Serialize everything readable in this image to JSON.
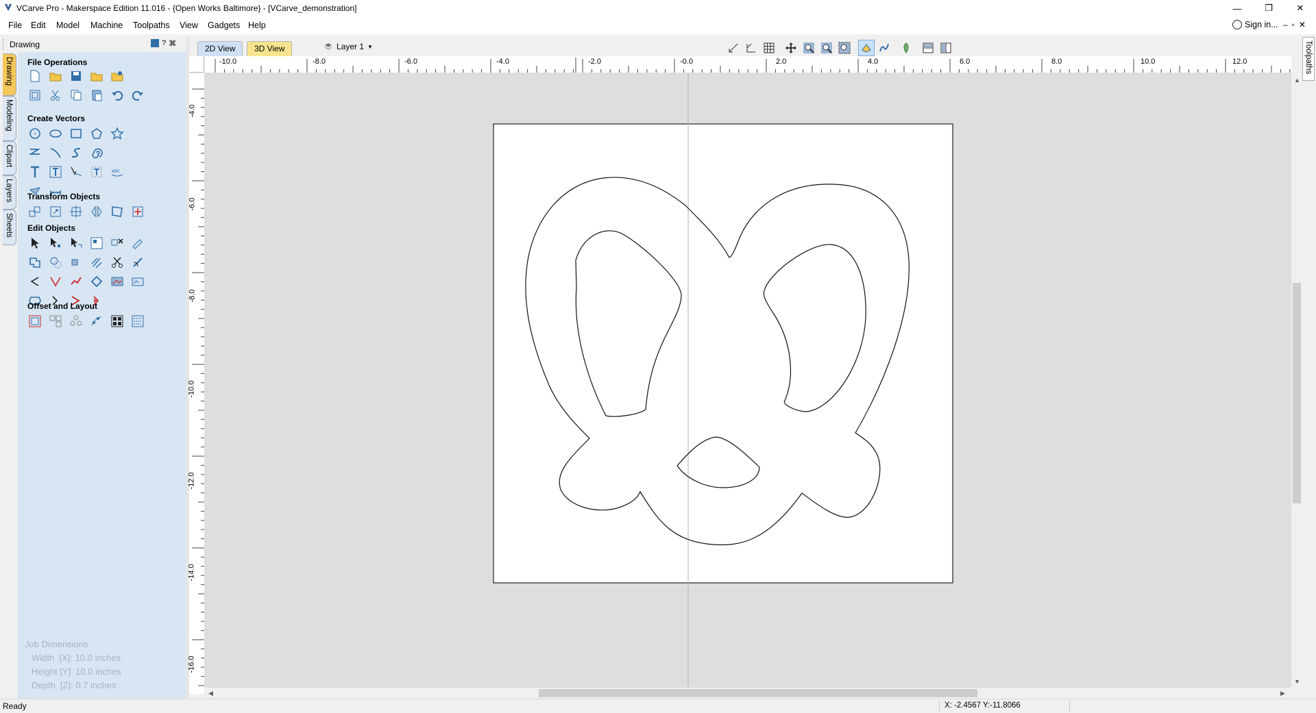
{
  "window": {
    "title": "VCarve Pro - Makerspace Edition 11.016 - {Open Works Baltimore} - [VCarve_demonstration]",
    "controls": [
      "minimize",
      "restore",
      "close"
    ]
  },
  "menu": {
    "items": [
      "File",
      "Edit",
      "Model",
      "Machine",
      "Toolpaths",
      "View",
      "Gadgets",
      "Help"
    ],
    "sign_in": "Sign in...",
    "mdi_controls": "–▫✕"
  },
  "left_panel": {
    "header": "Drawing",
    "header_buttons": [
      "?",
      "pin"
    ],
    "tabs": [
      "Drawing",
      "Modeling",
      "Clipart",
      "Layers",
      "Sheets"
    ],
    "sections": [
      {
        "title": "File Operations"
      },
      {
        "title": "Create Vectors"
      },
      {
        "title": "Transform Objects"
      },
      {
        "title": "Edit Objects"
      },
      {
        "title": "Offset and Layout"
      }
    ],
    "job_dimensions": {
      "title": "Job Dimensions",
      "width": "Width  [X]: 10.0 inches",
      "height": "Height [Y]: 10.0 inches",
      "depth": "Depth  [Z]: 0.7 inches"
    }
  },
  "view": {
    "tabs": [
      "2D View",
      "3D View"
    ],
    "active_tab": "2D View",
    "layer": "Layer 1",
    "h_ruler_labels": [
      "-10.0",
      "-8.0",
      "-6.0",
      "-4.0",
      "-2.0",
      "-0.0",
      "2.0",
      "4.0",
      "6.0",
      "8.0",
      "10.0",
      "12.0"
    ],
    "v_ruler_labels": [
      "-4.0",
      "-6.0",
      "-8.0",
      "-10.0",
      "-12.0",
      "-14.0",
      "-16.0"
    ]
  },
  "right_panel": {
    "tab": "Toolpaths"
  },
  "status": {
    "left": "Ready",
    "coords": "X: -2.4567 Y:-11.8066"
  },
  "colors": {
    "panel_bg": "#d8e6f4",
    "active_tab": "#f6c859",
    "canvas_bg": "#dedede",
    "icon_blue": "#2f6ea8"
  }
}
